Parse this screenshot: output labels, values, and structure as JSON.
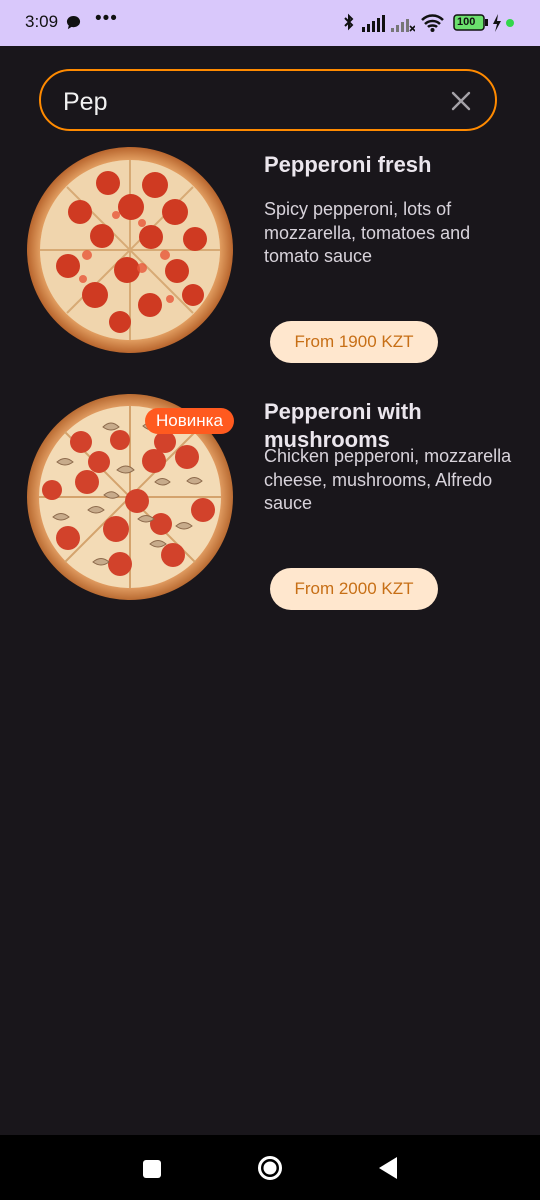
{
  "status_bar": {
    "time": "3:09",
    "battery": "100",
    "icons": [
      "message-icon",
      "more-dots-icon",
      "bluetooth-icon",
      "signal-icon",
      "signal-off-icon",
      "wifi-icon",
      "battery-icon",
      "charging-icon"
    ]
  },
  "search": {
    "value": "Pep",
    "placeholder": ""
  },
  "products": [
    {
      "title": "Pepperoni fresh",
      "description": "Spicy pepperoni, lots of mozzarella, tomatoes and tomato sauce",
      "price": "From 1900 KZT",
      "badge": ""
    },
    {
      "title": "Pepperoni with mushrooms",
      "description": "Chicken pepperoni, mozzarella cheese, mushrooms, Alfredo sauce",
      "price": "From 2000 KZT",
      "badge": "Новинка"
    }
  ],
  "navigation": {
    "buttons": [
      "recent-apps-button",
      "home-button",
      "back-button"
    ]
  },
  "colors": {
    "background": "#19161b",
    "status_bar": "#d9c8fb",
    "accent": "#ff8a00",
    "price_bg": "#ffe7ce",
    "price_text": "#c76f16",
    "badge": "#ff5a1f"
  }
}
